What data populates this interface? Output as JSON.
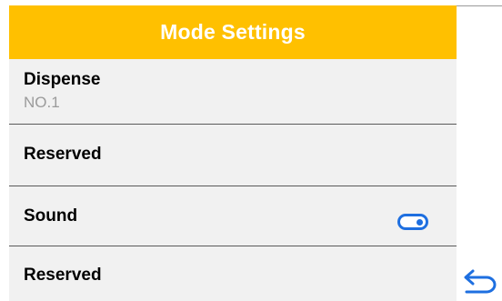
{
  "header": {
    "title": "Mode Settings"
  },
  "settings": {
    "items": [
      {
        "label": "Dispense",
        "value": "NO.1"
      },
      {
        "label": "Reserved"
      },
      {
        "label": "Sound",
        "toggle": "on"
      },
      {
        "label": "Reserved"
      }
    ]
  },
  "icons": {
    "back": "back-arrow-icon",
    "sound_toggle": "toggle-switch-icon"
  },
  "colors": {
    "header_background": "#ffc000",
    "header_text": "#ffffff",
    "panel_background": "#f1f1f1",
    "divider": "#5a5a5a",
    "subtext": "#9b9b9b",
    "accent": "#1e6fe0"
  }
}
